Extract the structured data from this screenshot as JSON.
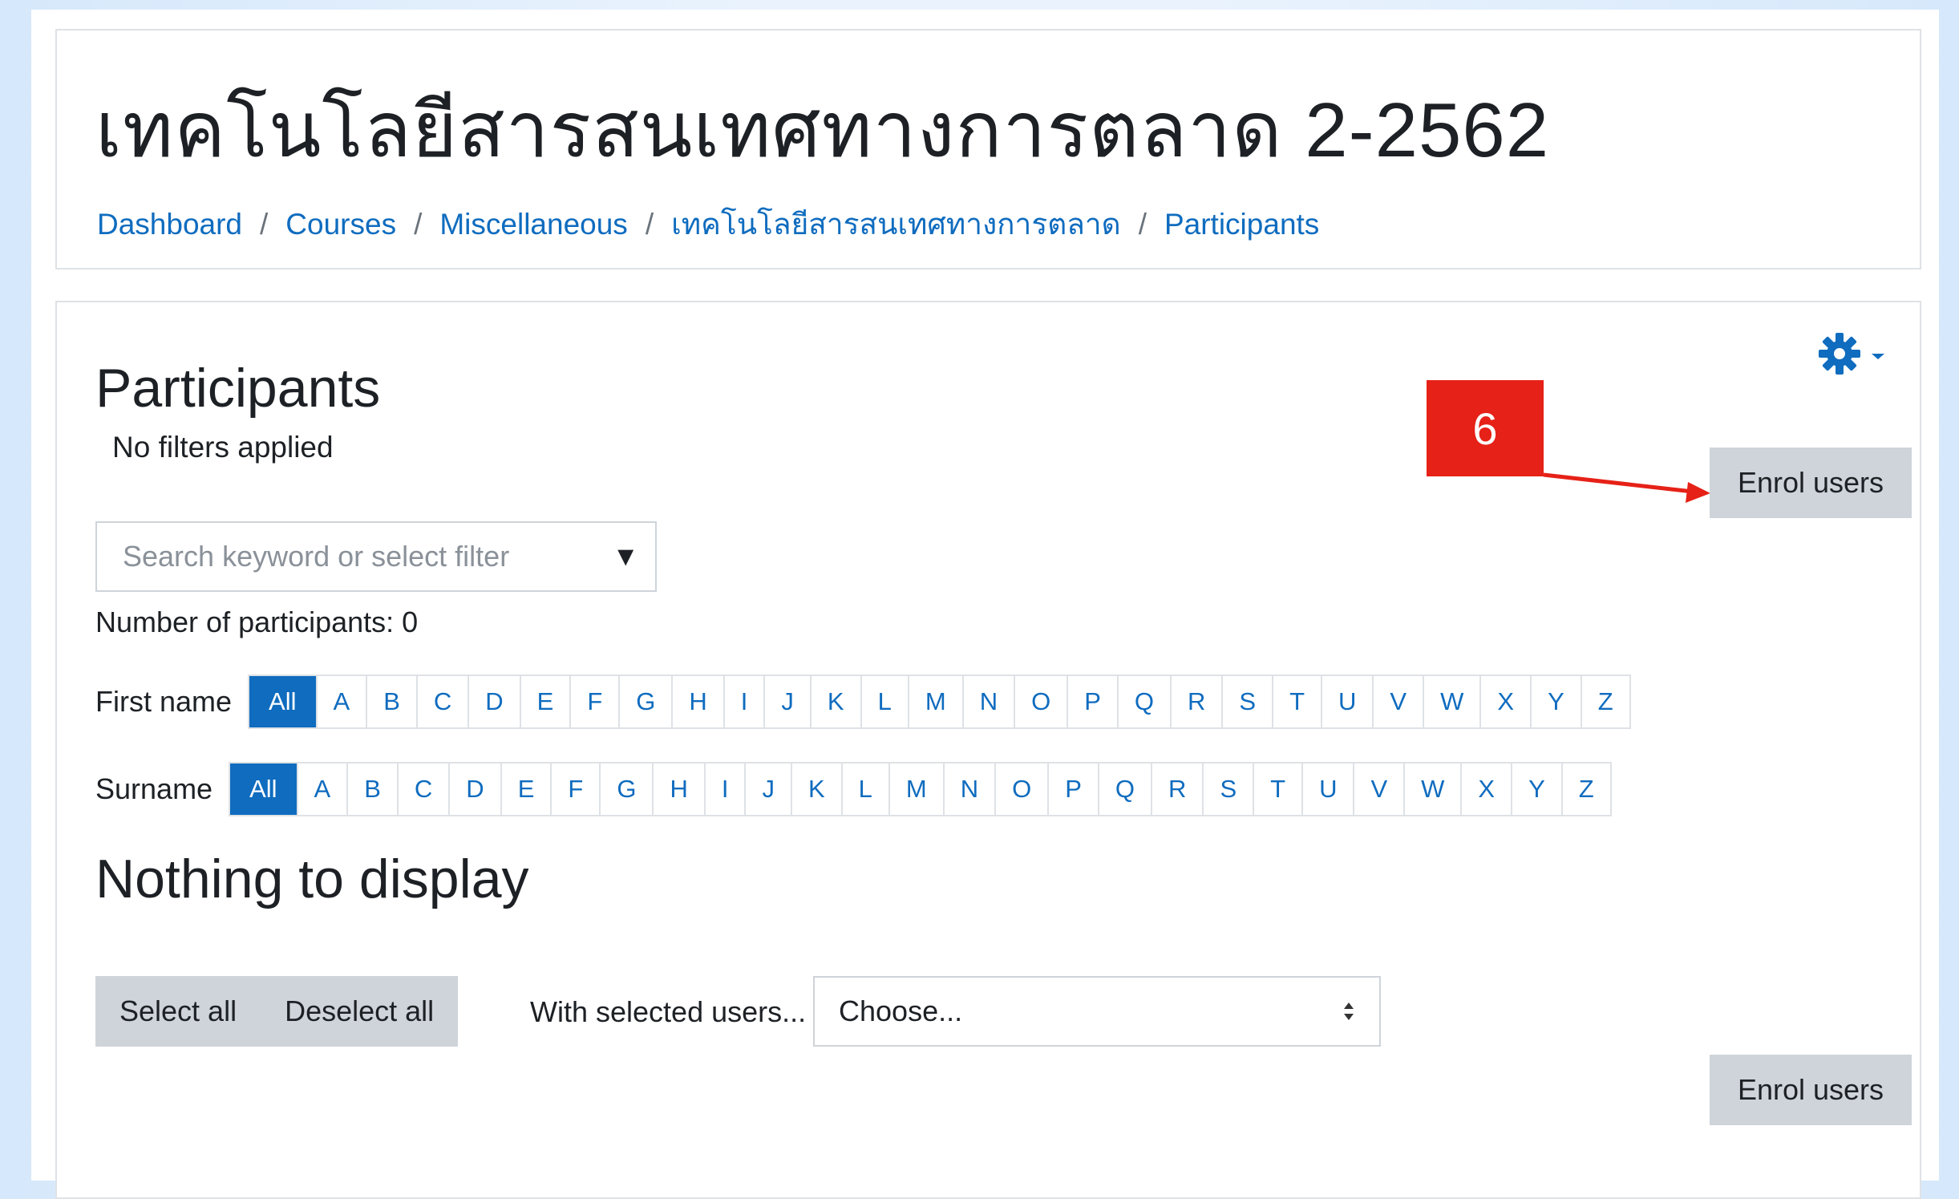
{
  "header": {
    "course_title": "เทคโนโลยีสารสนเทศทางการตลาด 2-2562",
    "breadcrumb": [
      "Dashboard",
      "Courses",
      "Miscellaneous",
      "เทคโนโลยีสารสนเทศทางการตลาด",
      "Participants"
    ],
    "breadcrumb_separator": "/"
  },
  "main": {
    "heading": "Participants",
    "filters_status": "No filters applied",
    "search": {
      "placeholder": "Search keyword or select filter",
      "value": "",
      "caret": "▼"
    },
    "participants_count": "Number of participants: 0",
    "first_name_label": "First name",
    "surname_label": "Surname",
    "initials": [
      "All",
      "A",
      "B",
      "C",
      "D",
      "E",
      "F",
      "G",
      "H",
      "I",
      "J",
      "K",
      "L",
      "M",
      "N",
      "O",
      "P",
      "Q",
      "R",
      "S",
      "T",
      "U",
      "V",
      "W",
      "X",
      "Y",
      "Z"
    ],
    "active_initial": "All",
    "empty_message": "Nothing to display",
    "select_all": "Select all",
    "deselect_all": "Deselect all",
    "with_selected_label": "With selected users...",
    "choose_value": "Choose...",
    "enrol_users": "Enrol users",
    "gear_icon": "gear-icon"
  },
  "annotation": {
    "label": "6",
    "color": "#e62117"
  },
  "colors": {
    "link": "#0f6cbf",
    "button_gray": "#ced4da",
    "border": "#dee2e6"
  }
}
